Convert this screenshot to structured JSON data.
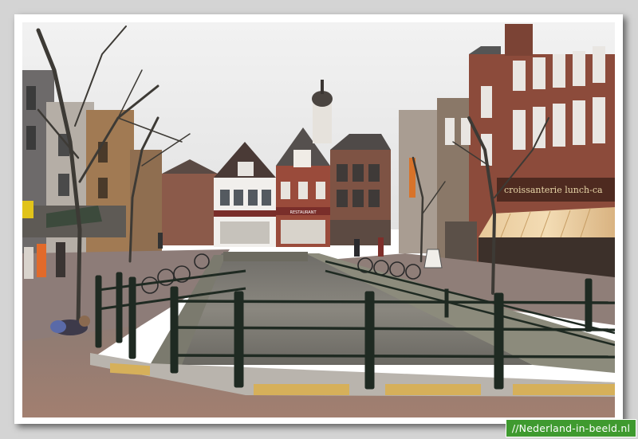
{
  "watermark": {
    "text": "//Nederland-in-beeld.nl",
    "background": "#3f9a2f"
  },
  "photo": {
    "signs": {
      "restaurant": "RESTAURANT",
      "shop_awning": "croissanterie lunch-ca"
    }
  },
  "colors": {
    "sky": "#e9e9e9",
    "brick": "#8a4a3a",
    "canal_water": "#7d7a72",
    "pavement": "#9a7f72",
    "railing": "#1f2a22"
  }
}
